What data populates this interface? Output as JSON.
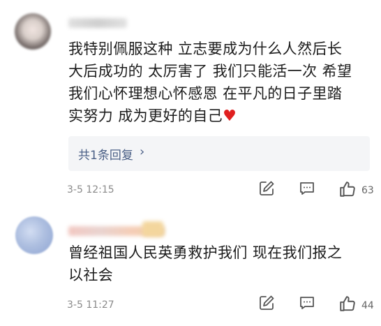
{
  "comments": [
    {
      "text_lines": [
        "我特别佩服这种 立志要成为什么人然后长",
        "大后成功的 太厉害了 我们只能活一次 希望",
        "我们心怀理想心怀感恩 在平凡的日子里踏",
        "实努力 成为更好的自己"
      ],
      "heart": "♥",
      "replies_label": "共1条回复",
      "replies_chevron": "›",
      "time": "3-5 12:15",
      "likes": "63"
    },
    {
      "text_lines": [
        "曾经祖国人民英勇救护我们 现在我们报之",
        "以社会"
      ],
      "time": "3-5 11:27",
      "likes": "44"
    }
  ],
  "colors": {
    "link": "#4a5f86",
    "heart": "#e02020",
    "meta": "#8a8a8a"
  },
  "icons": [
    "edit-icon",
    "comment-icon",
    "thumbs-up-icon"
  ]
}
